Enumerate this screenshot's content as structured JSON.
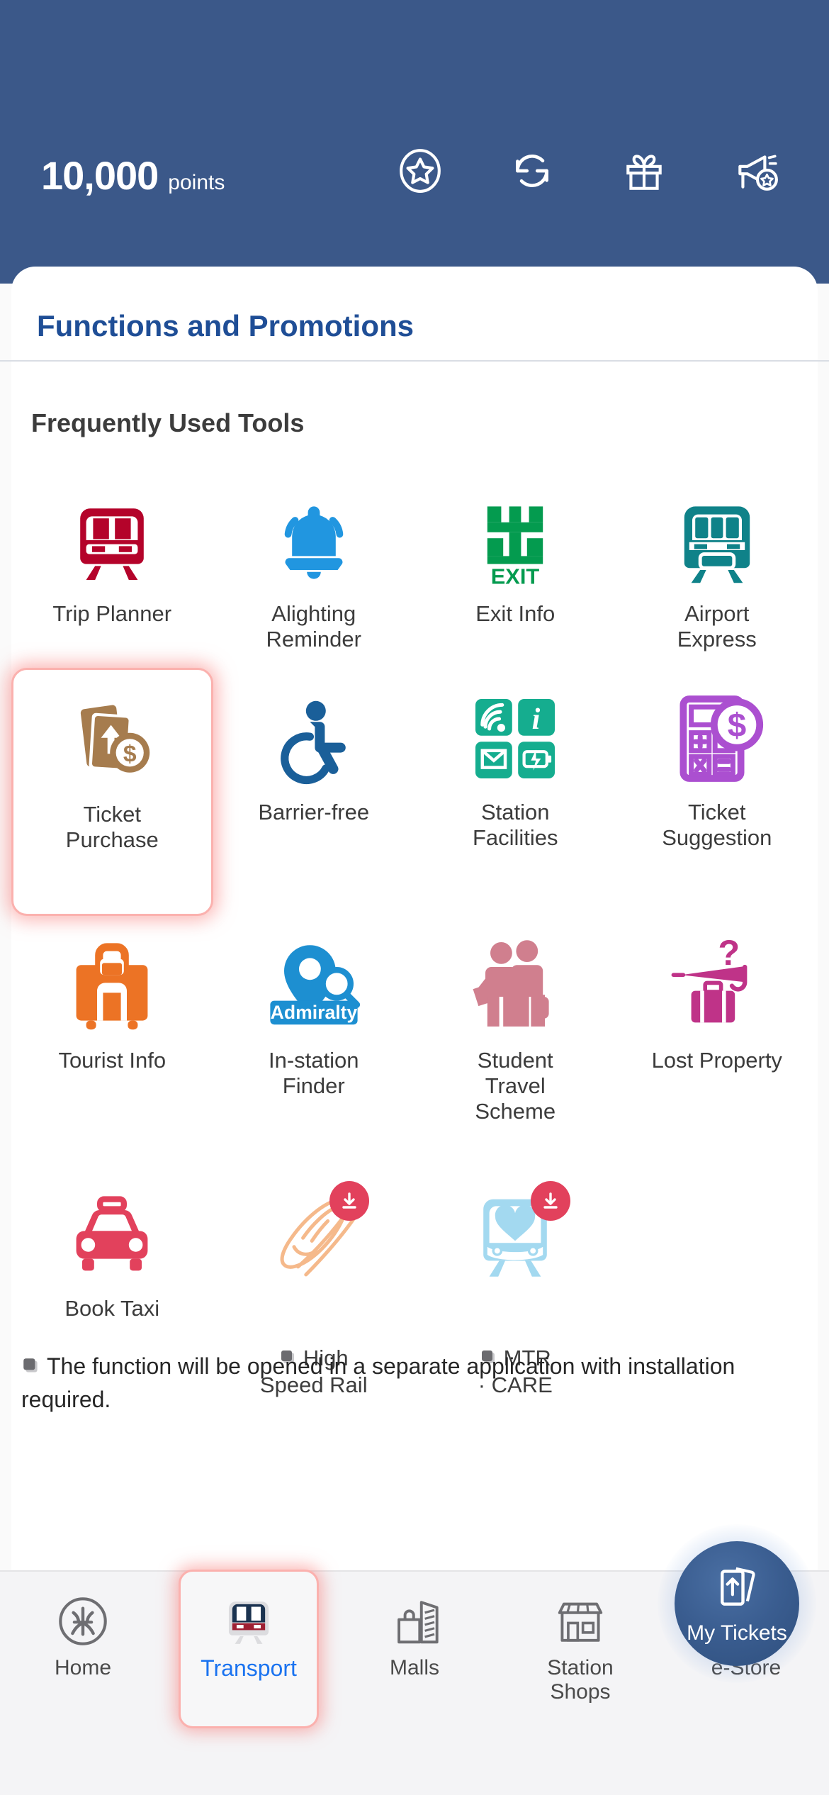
{
  "header": {
    "points_value": "10,000",
    "points_unit": "points",
    "icons": [
      {
        "name": "star-circle-icon",
        "label": "Rewards"
      },
      {
        "name": "refresh-icon",
        "label": "Refresh"
      },
      {
        "name": "gift-icon",
        "label": "Gifts"
      },
      {
        "name": "megaphone-star-icon",
        "label": "Promotions"
      }
    ]
  },
  "sheet": {
    "title": "Functions and Promotions",
    "section_title": "Frequently Used Tools"
  },
  "tools": [
    {
      "label": "Trip Planner",
      "icon": "train-red-icon",
      "selected": false,
      "external": false,
      "download": false
    },
    {
      "label": "Alighting\nReminder",
      "icon": "bell-icon",
      "selected": false,
      "external": false,
      "download": false
    },
    {
      "label": "Exit Info",
      "icon": "exit-sign-icon",
      "selected": false,
      "external": false,
      "download": false
    },
    {
      "label": "Airport\nExpress",
      "icon": "train-teal-icon",
      "selected": false,
      "external": false,
      "download": false
    },
    {
      "label": "Ticket\nPurchase",
      "icon": "ticket-dollar-icon",
      "selected": true,
      "external": false,
      "download": false
    },
    {
      "label": "Barrier-free",
      "icon": "wheelchair-icon",
      "selected": false,
      "external": false,
      "download": false
    },
    {
      "label": "Station\nFacilities",
      "icon": "facilities-grid-icon",
      "selected": false,
      "external": false,
      "download": false
    },
    {
      "label": "Ticket\nSuggestion",
      "icon": "calculator-dollar-icon",
      "selected": false,
      "external": false,
      "download": false
    },
    {
      "label": "Tourist Info",
      "icon": "suitcase-orange-icon",
      "selected": false,
      "external": false,
      "download": false
    },
    {
      "label": "In-station\nFinder",
      "icon": "map-pin-search-icon",
      "selected": false,
      "external": false,
      "download": false,
      "badge_text": "Admiralty"
    },
    {
      "label": "Student\nTravel\nScheme",
      "icon": "two-students-icon",
      "selected": false,
      "external": false,
      "download": false
    },
    {
      "label": "Lost Property",
      "icon": "umbrella-suitcase-question-icon",
      "selected": false,
      "external": false,
      "download": false
    },
    {
      "label": "Book Taxi",
      "icon": "taxi-icon",
      "selected": false,
      "external": false,
      "download": false
    },
    {
      "label": "High\nSpeed Rail",
      "icon": "high-speed-train-icon",
      "selected": false,
      "external": true,
      "download": true
    },
    {
      "label": "MTR\n· CARE",
      "icon": "train-heart-icon",
      "selected": false,
      "external": true,
      "download": true
    }
  ],
  "footnote": "The function will be opened in a separate application with installation required.",
  "bottom_nav": {
    "items": [
      {
        "label": "Home",
        "icon": "mtr-logo-icon",
        "active": false
      },
      {
        "label": "Transport",
        "icon": "train-nav-icon",
        "active": true
      },
      {
        "label": "Malls",
        "icon": "mall-icon",
        "active": false
      },
      {
        "label": "Station\nShops",
        "icon": "storefront-icon",
        "active": false
      },
      {
        "label": "e-Store",
        "icon": "cart-icon",
        "active": false
      }
    ],
    "fab": {
      "label": "My Tickets",
      "icon": "tickets-icon"
    }
  },
  "colors": {
    "header_blue": "#3b5889",
    "title_blue": "#1f4e96",
    "accent_pink": "#fbb1ae",
    "active_blue": "#1a73f0",
    "trip_red": "#b4032a",
    "bell_blue": "#2196e0",
    "exit_green": "#049b4f",
    "airport_teal": "#0f8289",
    "ticket_brown": "#a67c4e",
    "wheelchair_blue": "#1a5f99",
    "facility_teal": "#15ad8f",
    "suggestion_purple": "#ab4fd0",
    "tourist_orange": "#ec7325",
    "finder_blue": "#1d8fd1",
    "student_rose": "#d07f8e",
    "lost_magenta": "#bf3388",
    "taxi_red": "#e2415c",
    "hsr_peach": "#f5b98b",
    "care_blue": "#a3d9f0",
    "badge_red": "#e2415c"
  }
}
